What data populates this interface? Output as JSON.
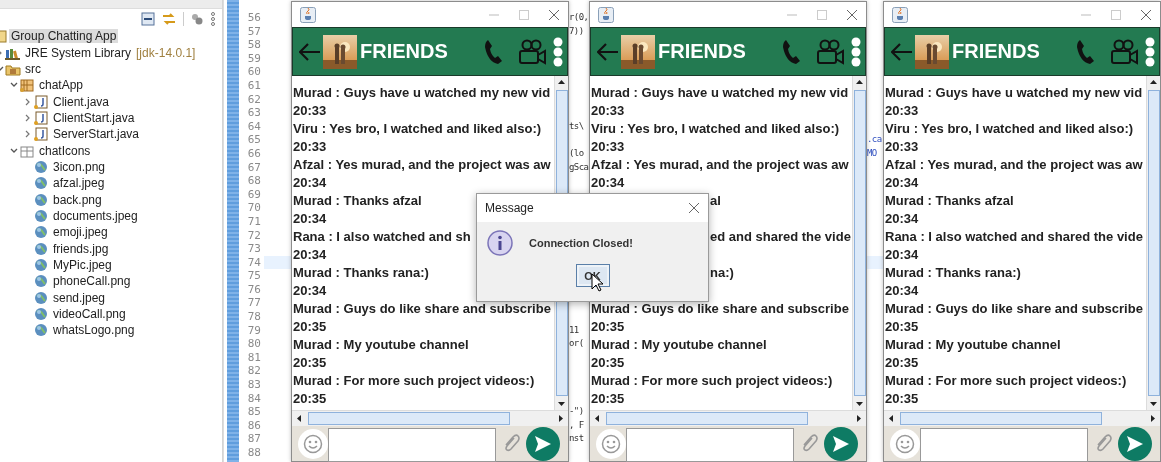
{
  "explorer": {
    "tree": [
      {
        "label": "Group Chatting App",
        "kind": "project",
        "selected": true,
        "children": [
          {
            "label": "JRE System Library",
            "decoration": "[jdk-14.0.1]",
            "kind": "library",
            "expanded": false,
            "selected": false
          },
          {
            "label": "src",
            "kind": "source-folder",
            "expanded": true,
            "selected": false,
            "children": [
              {
                "label": "chatApp",
                "kind": "package",
                "expanded": true,
                "selected": false,
                "children": [
                  {
                    "label": "Client.java",
                    "kind": "java",
                    "expanded": false,
                    "selected": false
                  },
                  {
                    "label": "ClientStart.java",
                    "kind": "java",
                    "expanded": false,
                    "selected": false
                  },
                  {
                    "label": "ServerStart.java",
                    "kind": "java",
                    "expanded": false,
                    "selected": false
                  }
                ]
              },
              {
                "label": "chatIcons",
                "kind": "package-empty",
                "expanded": true,
                "selected": false,
                "children": [
                  {
                    "label": "3icon.png",
                    "selected": false
                  },
                  {
                    "label": "afzal.jpeg",
                    "selected": false
                  },
                  {
                    "label": "back.png",
                    "selected": false
                  },
                  {
                    "label": "documents.jpeg",
                    "selected": false
                  },
                  {
                    "label": "emoji.jpeg",
                    "selected": false
                  },
                  {
                    "label": "friends.jpg",
                    "selected": false
                  },
                  {
                    "label": "MyPic.jpeg",
                    "selected": false
                  },
                  {
                    "label": "phoneCall.png",
                    "selected": false
                  },
                  {
                    "label": "send.jpeg",
                    "selected": false
                  },
                  {
                    "label": "videoCall.png",
                    "selected": false
                  },
                  {
                    "label": "whatsLogo.png",
                    "selected": false
                  }
                ]
              }
            ]
          }
        ]
      }
    ]
  },
  "editor": {
    "lines": [
      {
        "number": "56",
        "current": false,
        "fragment_a": "r(0,"
      },
      {
        "number": "57",
        "current": false,
        "fragment_a": "7))"
      },
      {
        "number": "58",
        "current": false
      },
      {
        "number": "59",
        "current": false
      },
      {
        "number": "60",
        "current": false
      },
      {
        "number": "61",
        "current": false
      },
      {
        "number": "62",
        "current": false
      },
      {
        "number": "63",
        "current": false
      },
      {
        "number": "64",
        "current": false,
        "fragment_a": "ts\\"
      },
      {
        "number": "65",
        "current": false,
        "fragment_b": ".ca"
      },
      {
        "number": "66",
        "current": false,
        "fragment_a": "(lo",
        "fragment_b": "MO"
      },
      {
        "number": "67",
        "current": false,
        "fragment_a": "gSca"
      },
      {
        "number": "68",
        "current": false
      },
      {
        "number": "69",
        "current": false
      },
      {
        "number": "70",
        "current": false
      },
      {
        "number": "71",
        "current": false
      },
      {
        "number": "72",
        "current": false
      },
      {
        "number": "73",
        "current": false
      },
      {
        "number": "74",
        "current": true
      },
      {
        "number": "75",
        "current": false
      },
      {
        "number": "76",
        "current": false
      },
      {
        "number": "77",
        "current": false
      },
      {
        "number": "78",
        "current": false
      },
      {
        "number": "79",
        "current": false,
        "fragment_a": "11"
      },
      {
        "number": "80",
        "current": false,
        "fragment_a": "or("
      },
      {
        "number": "81",
        "current": false
      },
      {
        "number": "82",
        "current": false
      },
      {
        "number": "83",
        "current": false
      },
      {
        "number": "84",
        "current": false
      },
      {
        "number": "85",
        "current": false,
        "fragment_a": "-\")"
      },
      {
        "number": "86",
        "current": false,
        "fragment_a": ", F"
      },
      {
        "number": "87",
        "current": false,
        "fragment_a": "nst"
      },
      {
        "number": "88",
        "current": false
      }
    ]
  },
  "chat_windows": [
    {
      "title": "FRIENDS",
      "messages": [
        {
          "kind": "line",
          "text": "Murad : Guys have u watched my new vid"
        },
        {
          "kind": "line",
          "text": "20:33"
        },
        {
          "kind": "line",
          "text": "Viru : Yes bro, I watched and liked also:)"
        },
        {
          "kind": "line",
          "text": "20:33"
        },
        {
          "kind": "line",
          "text": "Afzal : Yes murad, and the project was aw"
        },
        {
          "kind": "line",
          "text": "20:34"
        },
        {
          "kind": "line",
          "text": "Murad : Thanks afzal"
        },
        {
          "kind": "line",
          "text": "20:34"
        },
        {
          "kind": "line",
          "text": "Rana : I also watched and sh"
        },
        {
          "kind": "line",
          "text": "20:34"
        },
        {
          "kind": "line",
          "text": "Murad : Thanks rana:)"
        },
        {
          "kind": "line",
          "text": "20:34"
        },
        {
          "kind": "line",
          "text": "Murad : Guys do like share and subscribe"
        },
        {
          "kind": "line",
          "text": "20:35"
        },
        {
          "kind": "line",
          "text": "Murad : My youtube channel"
        },
        {
          "kind": "line",
          "text": "20:35"
        },
        {
          "kind": "line",
          "text": "Murad : For more such project videos:)"
        },
        {
          "kind": "line",
          "text": "20:35"
        }
      ]
    },
    {
      "title": "FRIENDS",
      "messages": [
        {
          "kind": "line",
          "text": "Murad : Guys have u watched my new vid"
        },
        {
          "kind": "line",
          "text": "20:33"
        },
        {
          "kind": "line",
          "text": "Viru : Yes bro, I watched and liked also:)"
        },
        {
          "kind": "line",
          "text": "20:33"
        },
        {
          "kind": "line",
          "text": "Afzal : Yes murad, and the project was aw"
        },
        {
          "kind": "line",
          "text": "20:34"
        },
        {
          "kind": "beside-dialog",
          "text": "al"
        },
        {
          "kind": "beside-dialog",
          "text": "ed and shared the vide"
        },
        {
          "kind": "beside-dialog",
          "text": "na:)"
        },
        {
          "kind": "line",
          "text": "Murad : Guys do like share and subscribe"
        },
        {
          "kind": "line",
          "text": "20:35"
        },
        {
          "kind": "line",
          "text": "Murad : My youtube channel"
        },
        {
          "kind": "line",
          "text": "20:35"
        },
        {
          "kind": "line",
          "text": "Murad : For more such project videos:)"
        },
        {
          "kind": "line",
          "text": "20:35"
        }
      ]
    },
    {
      "title": "FRIENDS",
      "messages": [
        {
          "kind": "line",
          "text": "Murad : Guys have u watched my new vid"
        },
        {
          "kind": "line",
          "text": "20:33"
        },
        {
          "kind": "line",
          "text": "Viru : Yes bro, I watched and liked also:)"
        },
        {
          "kind": "line",
          "text": "20:33"
        },
        {
          "kind": "line",
          "text": "Afzal : Yes murad, and the project was aw"
        },
        {
          "kind": "line",
          "text": "20:34"
        },
        {
          "kind": "line",
          "text": "Murad : Thanks afzal"
        },
        {
          "kind": "line",
          "text": "20:34"
        },
        {
          "kind": "line",
          "text": "Rana : I also watched and shared the vide"
        },
        {
          "kind": "line",
          "text": "20:34"
        },
        {
          "kind": "line",
          "text": "Murad : Thanks rana:)"
        },
        {
          "kind": "line",
          "text": "20:34"
        },
        {
          "kind": "line",
          "text": "Murad : Guys do like share and subscribe"
        },
        {
          "kind": "line",
          "text": "20:35"
        },
        {
          "kind": "line",
          "text": "Murad : My youtube channel"
        },
        {
          "kind": "line",
          "text": "20:35"
        },
        {
          "kind": "line",
          "text": "Murad : For more such project videos:)"
        },
        {
          "kind": "line",
          "text": "20:35"
        }
      ]
    }
  ],
  "dialog": {
    "title": "Message",
    "message": "Connection Closed!",
    "button": "OK"
  }
}
